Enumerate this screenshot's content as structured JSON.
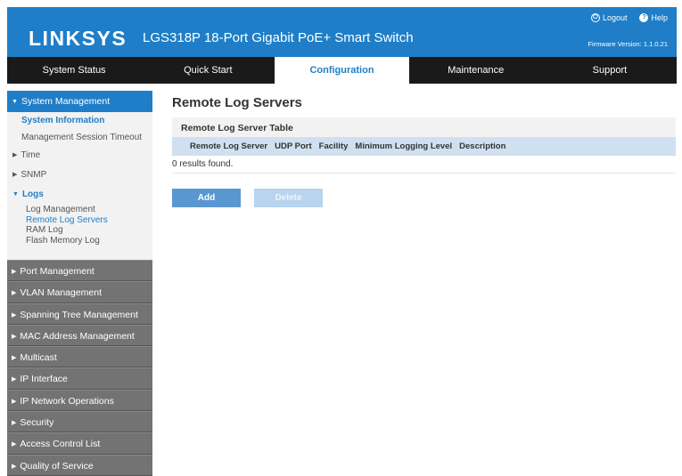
{
  "header": {
    "logo": "LINKSYS",
    "product": "LGS318P 18-Port Gigabit PoE+ Smart Switch",
    "logout": "Logout",
    "help": "Help",
    "firmware": "Firmware Version: 1.1.0.21"
  },
  "nav": {
    "tabs": [
      "System Status",
      "Quick Start",
      "Configuration",
      "Maintenance",
      "Support"
    ],
    "active": "Configuration"
  },
  "sidebar": {
    "open_section": "System Management",
    "items": {
      "system_information": "System Information",
      "management_session_timeout": "Management Session Timeout",
      "time": "Time",
      "snmp": "SNMP",
      "logs": "Logs",
      "log_management": "Log Management",
      "remote_log_servers": "Remote Log Servers",
      "ram_log": "RAM Log",
      "flash_memory_log": "Flash Memory Log"
    },
    "collapsed": [
      "Port Management",
      "VLAN Management",
      "Spanning Tree Management",
      "MAC Address Management",
      "Multicast",
      "IP Interface",
      "IP Network Operations",
      "Security",
      "Access Control List",
      "Quality of Service"
    ]
  },
  "main": {
    "title": "Remote Log Servers",
    "table_caption": "Remote Log Server Table",
    "columns": [
      "Remote Log Server",
      "UDP Port",
      "Facility",
      "Minimum Logging Level",
      "Description"
    ],
    "empty_message": "0 results found.",
    "add_label": "Add",
    "delete_label": "Delete"
  },
  "colors": {
    "brand_blue": "#1f7ec7",
    "nav_bg": "#1a1a1a",
    "sidebar_collapsed": "#737373",
    "table_header": "#cfe0f0"
  }
}
